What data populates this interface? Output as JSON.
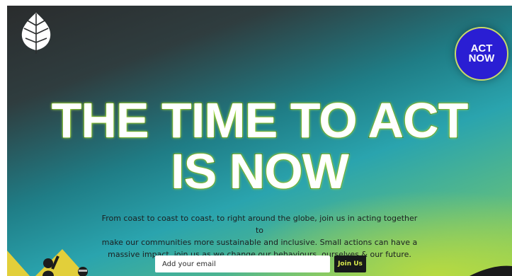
{
  "brand": {
    "logo_icon": "leaf-icon"
  },
  "badge": {
    "line1": "ACT",
    "line2": "NOW",
    "color": "#2a1ed3"
  },
  "headline": {
    "line1": "THE TIME TO ACT",
    "line2": "IS NOW"
  },
  "body": {
    "line1": "From coast to coast to coast, to right around the globe, join us in acting together to",
    "line2": "make our communities more sustainable and inclusive. Small actions can have a",
    "line3": "massive impact, join us as we change our behaviours, ourselves & our future."
  },
  "signup": {
    "email_placeholder": "Add your email",
    "button_label": "Join Us"
  },
  "colors": {
    "accent": "#d7e84c",
    "button_bg": "#16191a"
  }
}
